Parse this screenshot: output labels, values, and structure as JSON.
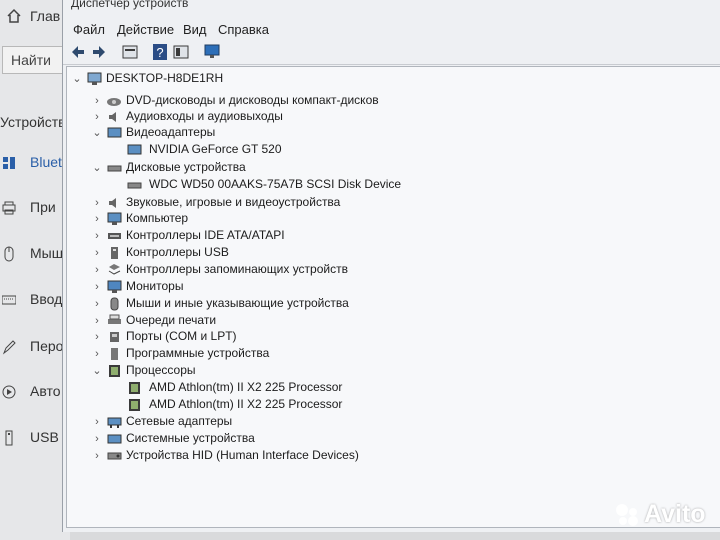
{
  "settings_window": {
    "title": "Глав",
    "search_placeholder": "Найти",
    "section_label": "Устройств",
    "items": [
      {
        "label": "Bluet",
        "icon": "bluetooth-devices-icon"
      },
      {
        "label": "При",
        "icon": "printer-icon"
      },
      {
        "label": "Мыш",
        "icon": "mouse-icon"
      },
      {
        "label": "Ввод",
        "icon": "keyboard-icon"
      },
      {
        "label": "Перо",
        "icon": "pen-icon"
      },
      {
        "label": "Авто",
        "icon": "autoplay-icon"
      },
      {
        "label": "USB",
        "icon": "usb-icon"
      }
    ]
  },
  "device_manager": {
    "title": "Диспетчер устройств",
    "menu": [
      "Файл",
      "Действие",
      "Вид",
      "Справка"
    ],
    "toolbar": [
      "back-icon",
      "forward-icon",
      "properties-icon",
      "help-icon",
      "details-icon",
      "monitor-icon"
    ],
    "root": "DESKTOP-H8DE1RH",
    "tree": [
      {
        "label": "DVD-дисководы и дисководы компакт-дисков",
        "expanded": false,
        "icon": "dvd-icon"
      },
      {
        "label": "Аудиовходы и аудиовыходы",
        "expanded": false,
        "icon": "speaker-icon"
      },
      {
        "label": "Видеоадаптеры",
        "expanded": true,
        "icon": "display-adapter-icon",
        "children": [
          {
            "label": "NVIDIA GeForce GT 520",
            "icon": "display-adapter-icon"
          }
        ]
      },
      {
        "label": "Дисковые устройства",
        "expanded": true,
        "icon": "disk-icon",
        "children": [
          {
            "label": "WDC WD50 00AAKS-75A7B SCSI Disk Device",
            "icon": "disk-icon"
          }
        ]
      },
      {
        "label": "Звуковые, игровые и видеоустройства",
        "expanded": false,
        "icon": "speaker-icon"
      },
      {
        "label": "Компьютер",
        "expanded": false,
        "icon": "computer-icon"
      },
      {
        "label": "Контроллеры IDE ATA/ATAPI",
        "expanded": false,
        "icon": "ide-controller-icon"
      },
      {
        "label": "Контроллеры USB",
        "expanded": false,
        "icon": "usb-controller-icon"
      },
      {
        "label": "Контроллеры запоминающих устройств",
        "expanded": false,
        "icon": "storage-controller-icon"
      },
      {
        "label": "Мониторы",
        "expanded": false,
        "icon": "monitor-icon"
      },
      {
        "label": "Мыши и иные указывающие устройства",
        "expanded": false,
        "icon": "mouse-icon"
      },
      {
        "label": "Очереди печати",
        "expanded": false,
        "icon": "printer-icon"
      },
      {
        "label": "Порты (COM и LPT)",
        "expanded": false,
        "icon": "port-icon"
      },
      {
        "label": "Программные устройства",
        "expanded": false,
        "icon": "software-device-icon"
      },
      {
        "label": "Процессоры",
        "expanded": true,
        "icon": "processor-icon",
        "children": [
          {
            "label": "AMD Athlon(tm) II X2 225 Processor",
            "icon": "processor-icon"
          },
          {
            "label": "AMD Athlon(tm) II X2 225 Processor",
            "icon": "processor-icon"
          }
        ]
      },
      {
        "label": "Сетевые адаптеры",
        "expanded": false,
        "icon": "network-adapter-icon"
      },
      {
        "label": "Системные устройства",
        "expanded": false,
        "icon": "system-device-icon"
      },
      {
        "label": "Устройства HID (Human Interface Devices)",
        "expanded": false,
        "icon": "hid-icon"
      }
    ]
  },
  "watermark": {
    "text": "Avito"
  }
}
